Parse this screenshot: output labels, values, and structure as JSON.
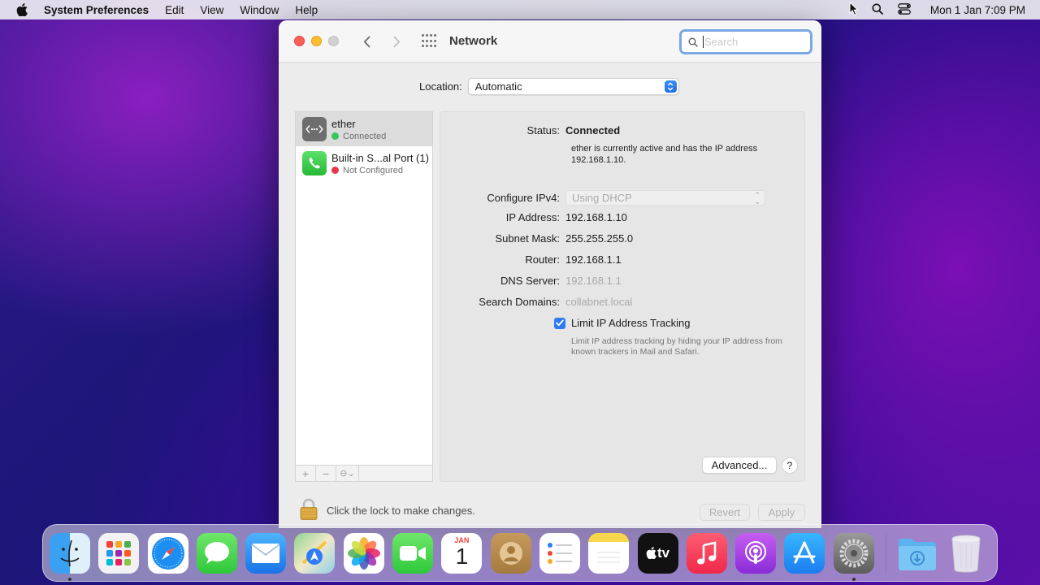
{
  "menubar": {
    "app_name": "System Preferences",
    "items": [
      "Edit",
      "View",
      "Window",
      "Help"
    ],
    "clock": "Mon 1 Jan  7:09 PM"
  },
  "window": {
    "title": "Network",
    "search_placeholder": "Search",
    "search_value": ""
  },
  "location": {
    "label": "Location:",
    "value": "Automatic"
  },
  "interfaces": [
    {
      "name": "ether",
      "status": "Connected",
      "status_color": "#34c759",
      "icon": "ethernet-icon"
    },
    {
      "name": "Built-in S...al Port (1)",
      "status": "Not Configured",
      "status_color": "#e8374c",
      "icon": "phone-icon"
    }
  ],
  "list_tools": {
    "add": "+",
    "remove": "−",
    "action": "⊖⌄"
  },
  "details": {
    "status_label": "Status:",
    "status_value": "Connected",
    "status_desc": "ether is currently active and has the IP address 192.168.1.10.",
    "configure_label": "Configure IPv4:",
    "configure_value": "Using DHCP",
    "ip_label": "IP Address:",
    "ip_value": "192.168.1.10",
    "subnet_label": "Subnet Mask:",
    "subnet_value": "255.255.255.0",
    "router_label": "Router:",
    "router_value": "192.168.1.1",
    "dns_label": "DNS Server:",
    "dns_value": "192.168.1.1",
    "domains_label": "Search Domains:",
    "domains_value": "collabnet.local",
    "limit_label": "Limit IP Address Tracking",
    "limit_checked": true,
    "limit_desc": "Limit IP address tracking by hiding your IP address from known trackers in Mail and Safari.",
    "advanced_label": "Advanced...",
    "help_label": "?"
  },
  "footer": {
    "lock_text": "Click the lock to make changes.",
    "revert_label": "Revert",
    "apply_label": "Apply"
  },
  "dock": [
    {
      "name": "finder",
      "running": true
    },
    {
      "name": "launchpad",
      "running": false
    },
    {
      "name": "safari",
      "running": false
    },
    {
      "name": "messages",
      "running": false
    },
    {
      "name": "mail",
      "running": false
    },
    {
      "name": "maps",
      "running": false
    },
    {
      "name": "photos",
      "running": false
    },
    {
      "name": "facetime",
      "running": false
    },
    {
      "name": "calendar",
      "running": false,
      "month": "JAN",
      "day": "1"
    },
    {
      "name": "contacts",
      "running": false
    },
    {
      "name": "reminders",
      "running": false
    },
    {
      "name": "notes",
      "running": false
    },
    {
      "name": "tv",
      "running": false,
      "label": "tv"
    },
    {
      "name": "music",
      "running": false
    },
    {
      "name": "podcasts",
      "running": false
    },
    {
      "name": "app-store",
      "running": false
    },
    {
      "name": "system-preferences",
      "running": true
    },
    {
      "name": "downloads",
      "running": false
    },
    {
      "name": "trash",
      "running": false
    }
  ],
  "colors": {
    "accent": "#2f7cf6",
    "connected": "#34c759",
    "not_configured": "#e8374c"
  }
}
